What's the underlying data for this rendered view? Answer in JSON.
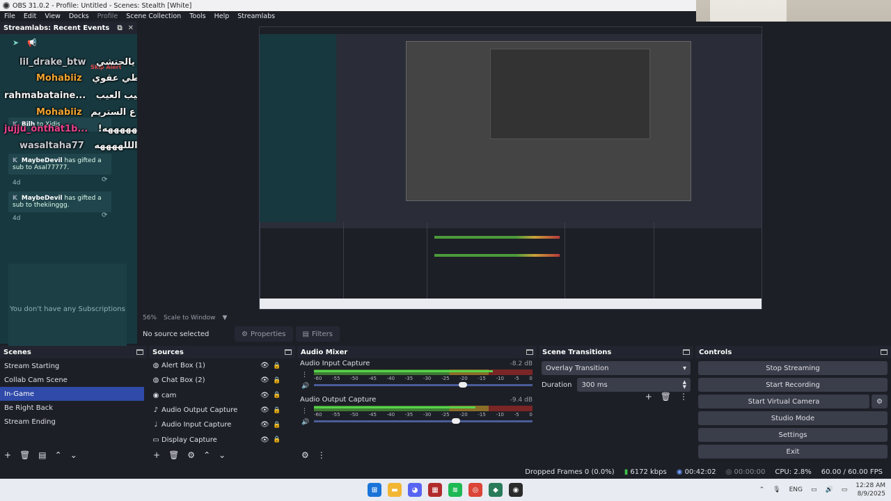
{
  "window": {
    "title": "OBS 31.0.2 - Profile: Untitled - Scenes: Stealth [White]"
  },
  "menu": [
    "File",
    "Edit",
    "View",
    "Docks",
    "Profile",
    "Scene Collection",
    "Tools",
    "Help",
    "Streamlabs"
  ],
  "events_panel": {
    "title": "Streamlabs: Recent Events",
    "cards": [
      {
        "user": "MaybeDevil",
        "text": "has gifted a sub to Asal77777.",
        "time": "4d"
      },
      {
        "user": "MaybeDevil",
        "text": "has gifted a sub to thekiinggg.",
        "time": "4d"
      }
    ],
    "partial_card": {
      "user": "Bilh",
      "text": "to Xjdjs."
    },
    "empty_text": "You don't have any Subscriptions"
  },
  "chat": {
    "skip_alert": "Skip Alert",
    "lines": [
      {
        "user": "lil_drake_btw",
        "msg": "واو يالحتشي"
      },
      {
        "user": "Mohabiiz",
        "msg": "محمد ايهاب يعطي عقوي"
      },
      {
        "user": "rahmabataine...",
        "msg": "يا عيب العيب"
      },
      {
        "user": "Mohabiiz",
        "msg": "ومش عارف اني ع الستريم"
      },
      {
        "user": "jujju_onthat1b...",
        "msg": "!هههههههههه"
      },
      {
        "user": "wasaltaha77",
        "msg": "استغفرالللههههه"
      }
    ]
  },
  "preview": {
    "zoom": "56%",
    "scale_mode": "Scale to Window"
  },
  "toolbar": {
    "no_source": "No source selected",
    "properties": "Properties",
    "filters": "Filters"
  },
  "scenes": {
    "title": "Scenes",
    "items": [
      "Stream Starting",
      "Collab Cam Scene",
      "In-Game",
      "Be Right Back",
      "Stream Ending"
    ],
    "active_index": 2
  },
  "sources": {
    "title": "Sources",
    "items": [
      {
        "name": "Alert Box (1)",
        "icon": "browser-icon"
      },
      {
        "name": "Chat Box (2)",
        "icon": "browser-icon"
      },
      {
        "name": "cam",
        "icon": "camera-icon"
      },
      {
        "name": "Audio Output Capture",
        "icon": "speaker-icon"
      },
      {
        "name": "Audio Input Capture",
        "icon": "mic-icon"
      },
      {
        "name": "Display Capture",
        "icon": "monitor-icon"
      }
    ]
  },
  "mixer": {
    "title": "Audio Mixer",
    "channels": [
      {
        "name": "Audio Input Capture",
        "db": "-8.2 dB",
        "level": 0.82,
        "fader": 0.68
      },
      {
        "name": "Audio Output Capture",
        "db": "-9.4 dB",
        "level": 0.74,
        "fader": 0.65
      }
    ],
    "ticks": [
      "-60",
      "-55",
      "-50",
      "-45",
      "-40",
      "-35",
      "-30",
      "-25",
      "-20",
      "-15",
      "-10",
      "-5",
      "0"
    ]
  },
  "transitions": {
    "title": "Scene Transitions",
    "selected": "Overlay Transition",
    "duration_label": "Duration",
    "duration": "300 ms"
  },
  "controls": {
    "title": "Controls",
    "buttons": [
      "Stop Streaming",
      "Start Recording",
      "Start Virtual Camera",
      "Studio Mode",
      "Settings",
      "Exit"
    ]
  },
  "status": {
    "dropped": "Dropped Frames 0 (0.0%)",
    "bitrate": "6172 kbps",
    "stream_time": "00:42:02",
    "rec_time": "00:00:00",
    "cpu": "CPU: 2.8%",
    "fps": "60.00 / 60.00 FPS"
  },
  "taskbar": {
    "lang": "ENG",
    "time": "12:28 AM",
    "date": "8/9/2025"
  },
  "colors": {
    "accent": "#2f4aa8",
    "panel": "#1d1f26",
    "events_bg": "#17383f"
  }
}
